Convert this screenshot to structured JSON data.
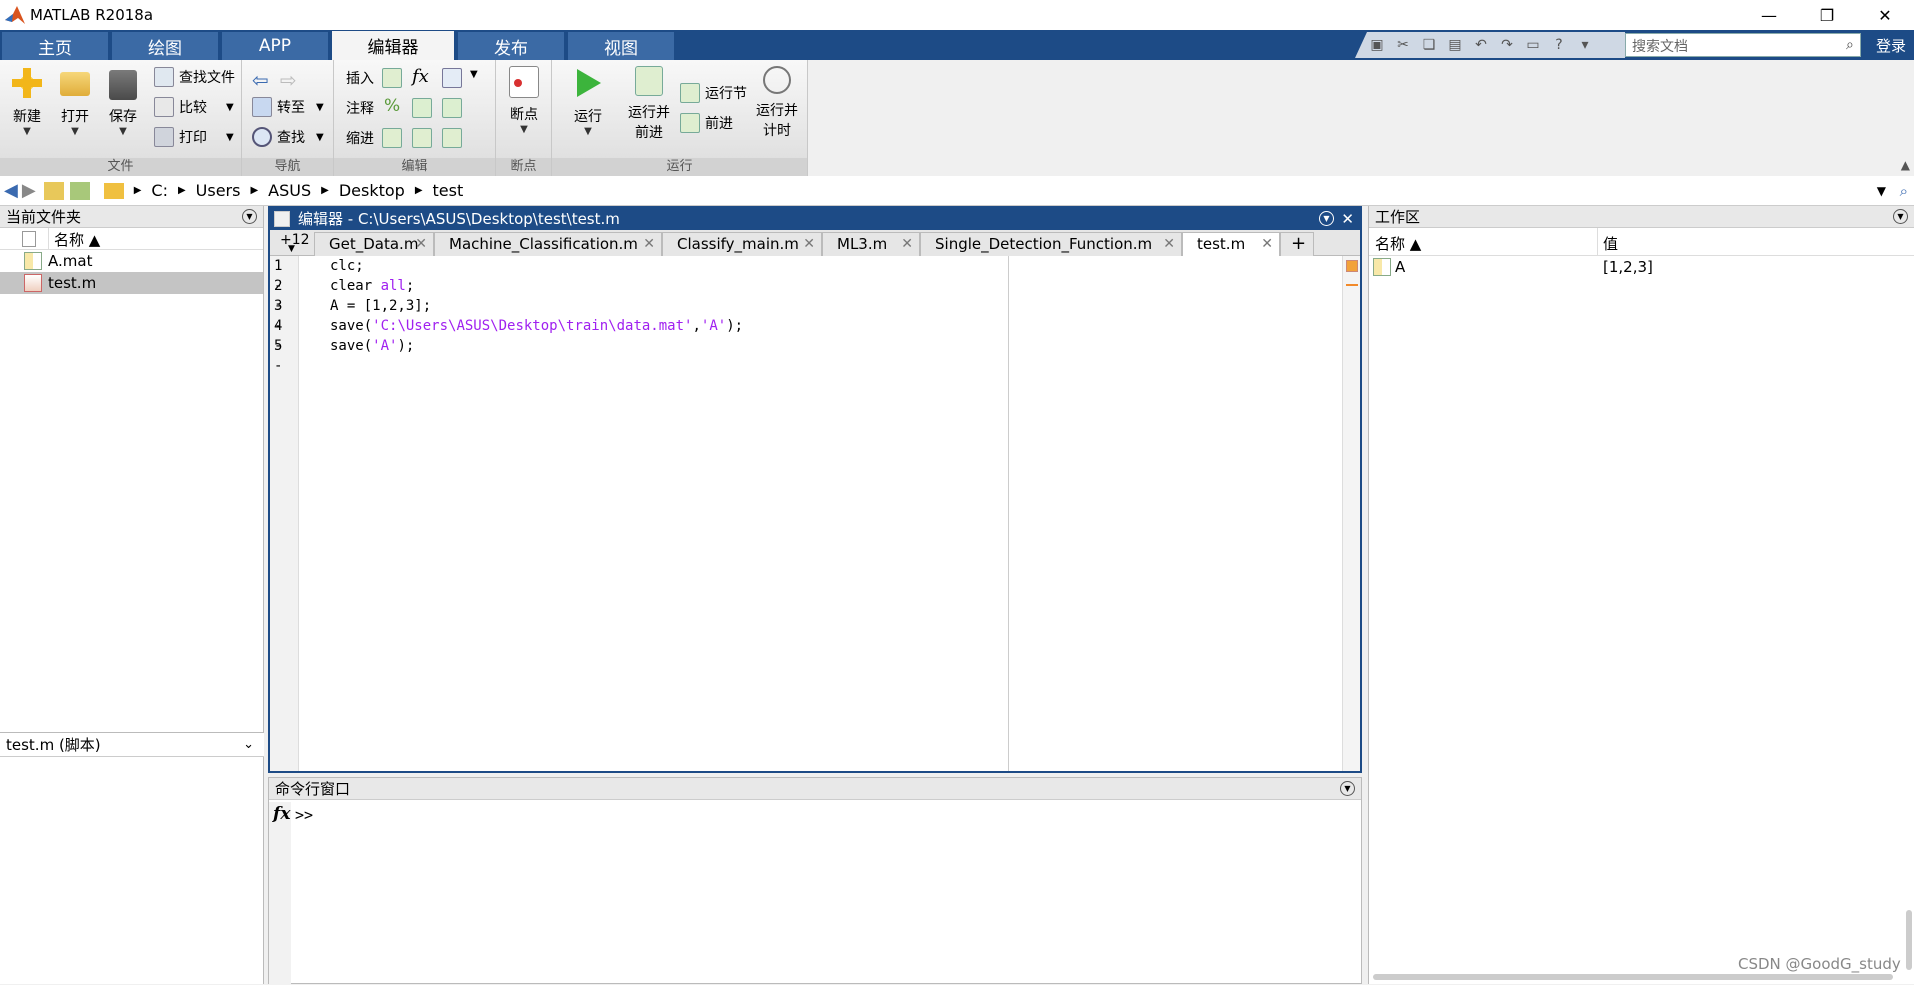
{
  "window": {
    "title": "MATLAB R2018a",
    "min": "—",
    "max": "❐",
    "close": "✕"
  },
  "ribbon_tabs": [
    "主页",
    "绘图",
    "APP",
    "编辑器",
    "发布",
    "视图"
  ],
  "search": {
    "placeholder": "搜索文档"
  },
  "login": "登录",
  "ribbon": {
    "file": {
      "label": "文件",
      "new": "新建",
      "open": "打开",
      "save": "保存",
      "find_files": "查找文件",
      "compare": "比较",
      "print": "打印"
    },
    "nav": {
      "label": "导航",
      "goto": "转至",
      "find": "查找"
    },
    "edit": {
      "label": "编辑",
      "insert": "插入",
      "comment": "注释",
      "indent": "缩进"
    },
    "breakpoint": {
      "label": "断点",
      "breakpoints": "断点"
    },
    "run": {
      "label": "运行",
      "run": "运行",
      "run_advance_1": "运行并",
      "run_advance_2": "前进",
      "run_section": "运行节",
      "advance": "前进",
      "run_time_1": "运行并",
      "run_time_2": "计时"
    }
  },
  "address": {
    "crumbs": [
      "C:",
      "Users",
      "ASUS",
      "Desktop",
      "test"
    ]
  },
  "current_folder": {
    "title": "当前文件夹",
    "col_name": "名称 ▲",
    "files": [
      {
        "name": "A.mat"
      },
      {
        "name": "test.m"
      }
    ]
  },
  "details": {
    "title": "test.m  (脚本)"
  },
  "editor": {
    "title": "编辑器 - C:\\Users\\ASUS\\Desktop\\test\\test.m",
    "overflow": "+12",
    "tabs": [
      "Get_Data.m",
      "Machine_Classification.m",
      "Classify_main.m",
      "ML3.m",
      "Single_Detection_Function.m",
      "test.m"
    ],
    "add": "+",
    "line_numbers": [
      "1",
      "2",
      "3",
      "4",
      "5"
    ],
    "code": {
      "l1": "clc;",
      "l2a": "clear ",
      "l2b": "all",
      "l2c": ";",
      "l3": "A = [1,2,3];",
      "l4a": "save(",
      "l4b": "'C:\\Users\\ASUS\\Desktop\\train\\data.mat'",
      "l4c": ",",
      "l4d": "'A'",
      "l4e": ");",
      "l5a": "save(",
      "l5b": "'A'",
      "l5c": ");"
    }
  },
  "command_window": {
    "title": "命令行窗口",
    "fx": "fx",
    "prompt": ">>"
  },
  "workspace": {
    "title": "工作区",
    "col_name": "名称 ▲",
    "col_value": "值",
    "vars": [
      {
        "name": "A",
        "value": "[1,2,3]"
      }
    ]
  },
  "watermark": "CSDN @GoodG_study"
}
